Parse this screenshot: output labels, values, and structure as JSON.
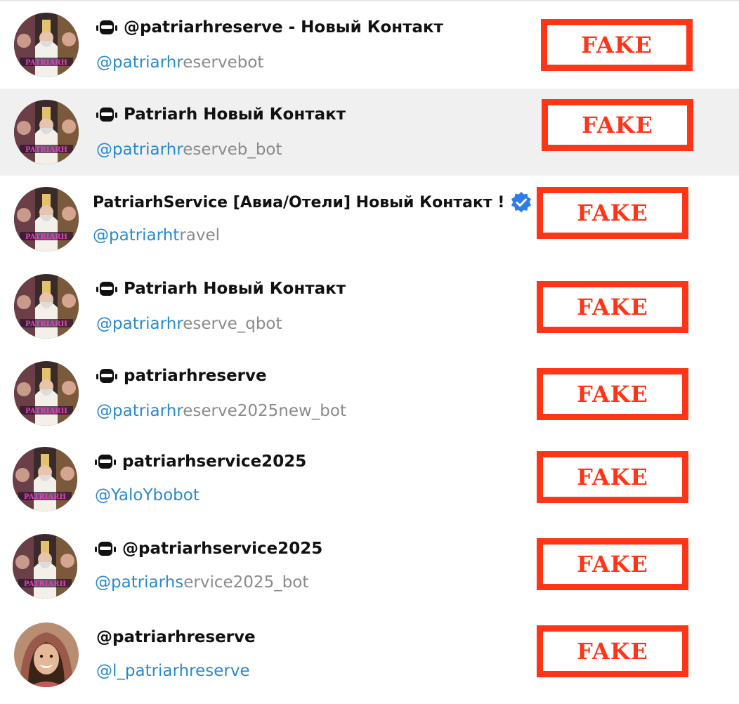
{
  "stamp_label": "FAKE",
  "colors": {
    "stamp": "#ff3518",
    "username_match": "#2a8ac9",
    "username_rest": "#8a8a8a",
    "highlight": "#f0f0f0",
    "verified": "#2d7ee8"
  },
  "results": [
    {
      "name": "@patriarhreserve - Новый Контакт",
      "is_bot": true,
      "verified": false,
      "username_match": "@patriarhr",
      "username_rest": "eservebot",
      "avatar": "patriarh-avatar"
    },
    {
      "name": "Patriarh Новый Контакт",
      "is_bot": true,
      "verified": false,
      "username_match": "@patriarhr",
      "username_rest": "eserveb_bot",
      "avatar": "patriarh-avatar"
    },
    {
      "name": "PatriarhService [Авиа/Отели] Новый Контакт !",
      "is_bot": false,
      "verified": true,
      "username_match": "@patriarht",
      "username_rest": "ravel",
      "avatar": "patriarh-avatar"
    },
    {
      "name": "Patriarh Новый Контакт",
      "is_bot": true,
      "verified": false,
      "username_match": "@patriarhr",
      "username_rest": "eserve_qbot",
      "avatar": "patriarh-avatar"
    },
    {
      "name": "patriarhreserve",
      "is_bot": true,
      "verified": false,
      "username_match": "@patriarhr",
      "username_rest": "eserve2025new_bot",
      "avatar": "patriarh-avatar"
    },
    {
      "name": "patriarhservice2025",
      "is_bot": true,
      "verified": false,
      "username_match": "@YaloYbobot",
      "username_rest": "",
      "avatar": "patriarh-avatar"
    },
    {
      "name": "@patriarhservice2025",
      "is_bot": true,
      "verified": false,
      "username_match": "@patriarhs",
      "username_rest": "ervice2025_bot",
      "avatar": "patriarh-avatar"
    },
    {
      "name": "@patriarhreserve",
      "is_bot": false,
      "verified": false,
      "username_match": "@l_patriarhreserve",
      "username_rest": "",
      "avatar": "woman-avatar"
    }
  ]
}
